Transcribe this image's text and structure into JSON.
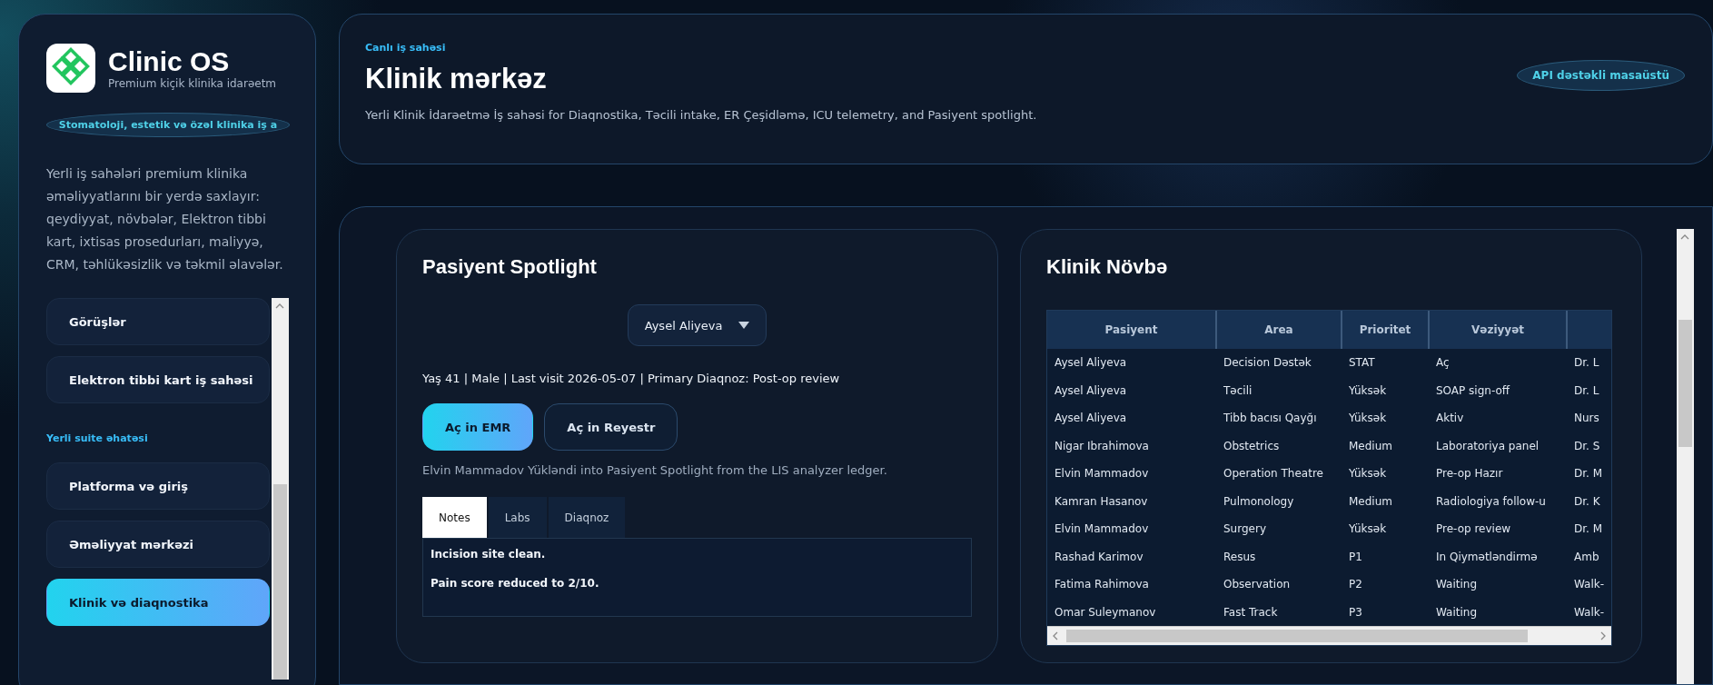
{
  "sidebar": {
    "brand": {
      "title": "Clinic OS",
      "subtitle": "Premium kiçik klinika idarəetm"
    },
    "pill": "Stomatoloji, estetik və özəl klinika iş a",
    "description": "Yerli iş sahələri premium klinika əməliyyatlarını bir yerdə saxlayır: qeydiyyat, növbələr, Elektron tibbi kart, ixtisas prosedurları, maliyyə, CRM, təhlükəsizlik və təkmil əlavələr.",
    "nav": [
      {
        "kind": "item",
        "label": "Görüşlər",
        "selected": false
      },
      {
        "kind": "item",
        "label": "Elektron tibbi kart iş sahəsi",
        "selected": false
      },
      {
        "kind": "section",
        "label": "Yerli suite əhatəsi"
      },
      {
        "kind": "item",
        "label": "Platforma və giriş",
        "selected": false
      },
      {
        "kind": "item",
        "label": "Əməliyyat mərkəzi",
        "selected": false
      },
      {
        "kind": "item",
        "label": "Klinik və diaqnostika",
        "selected": true
      }
    ]
  },
  "header": {
    "eyebrow": "Canlı iş sahəsi",
    "title": "Klinik mərkəz",
    "subtitle": "Yerli Klinik İdarəetmə İş sahəsi for Diaqnostika, Təcili intake, ER Çeşidləmə, ICU telemetry, and Pasiyent spotlight.",
    "badge": "API dəstəkli masaüstü"
  },
  "spotlight": {
    "title": "Pasiyent Spotlight",
    "patient_select": "Aysel Aliyeva",
    "meta": "Yaş 41 | Male | Last visit 2026-05-07 | Primary Diaqnoz: Post-op review",
    "buttons": [
      {
        "label": "Aç in EMR",
        "kind": "primary"
      },
      {
        "label": "Aç in Reyestr",
        "kind": "secondary"
      }
    ],
    "status": "Elvin Mammadov Yükləndi into Pasiyent Spotlight from the LIS analyzer ledger.",
    "tabs": [
      {
        "label": "Notes",
        "selected": true
      },
      {
        "label": "Labs",
        "selected": false
      },
      {
        "label": "Diaqnoz",
        "selected": false
      }
    ],
    "notes": [
      "Incision site clean.",
      "Pain score reduced to 2/10."
    ]
  },
  "queue": {
    "title": "Klinik Növbə",
    "columns": [
      "Pasiyent",
      "Area",
      "Prioritet",
      "Vəziyyət"
    ],
    "rows": [
      [
        "Aysel Aliyeva",
        "Decision Dəstək",
        "STAT",
        "Aç",
        "Dr. L"
      ],
      [
        "Aysel Aliyeva",
        "Təcili",
        "Yüksək",
        "SOAP sign-off",
        "Dr. L"
      ],
      [
        "Aysel Aliyeva",
        "Tibb bacısı Qayğı",
        "Yüksək",
        "Aktiv",
        "Nurs"
      ],
      [
        "Nigar Ibrahimova",
        "Obstetrics",
        "Medium",
        "Laboratoriya panel",
        "Dr. S"
      ],
      [
        "Elvin Mammadov",
        "Operation Theatre",
        "Yüksək",
        "Pre-op Hazır",
        "Dr. M"
      ],
      [
        "Kamran Hasanov",
        "Pulmonology",
        "Medium",
        "Radiologiya follow-u",
        "Dr. K"
      ],
      [
        "Elvin Mammadov",
        "Surgery",
        "Yüksək",
        "Pre-op review",
        "Dr. M"
      ],
      [
        "Rashad Karimov",
        "Resus",
        "P1",
        "In Qiymətləndirmə",
        "Amb"
      ],
      [
        "Fatima Rahimova",
        "Observation",
        "P2",
        "Waiting",
        "Walk-"
      ],
      [
        "Omar Suleymanov",
        "Fast Track",
        "P3",
        "Waiting",
        "Walk-"
      ]
    ]
  }
}
